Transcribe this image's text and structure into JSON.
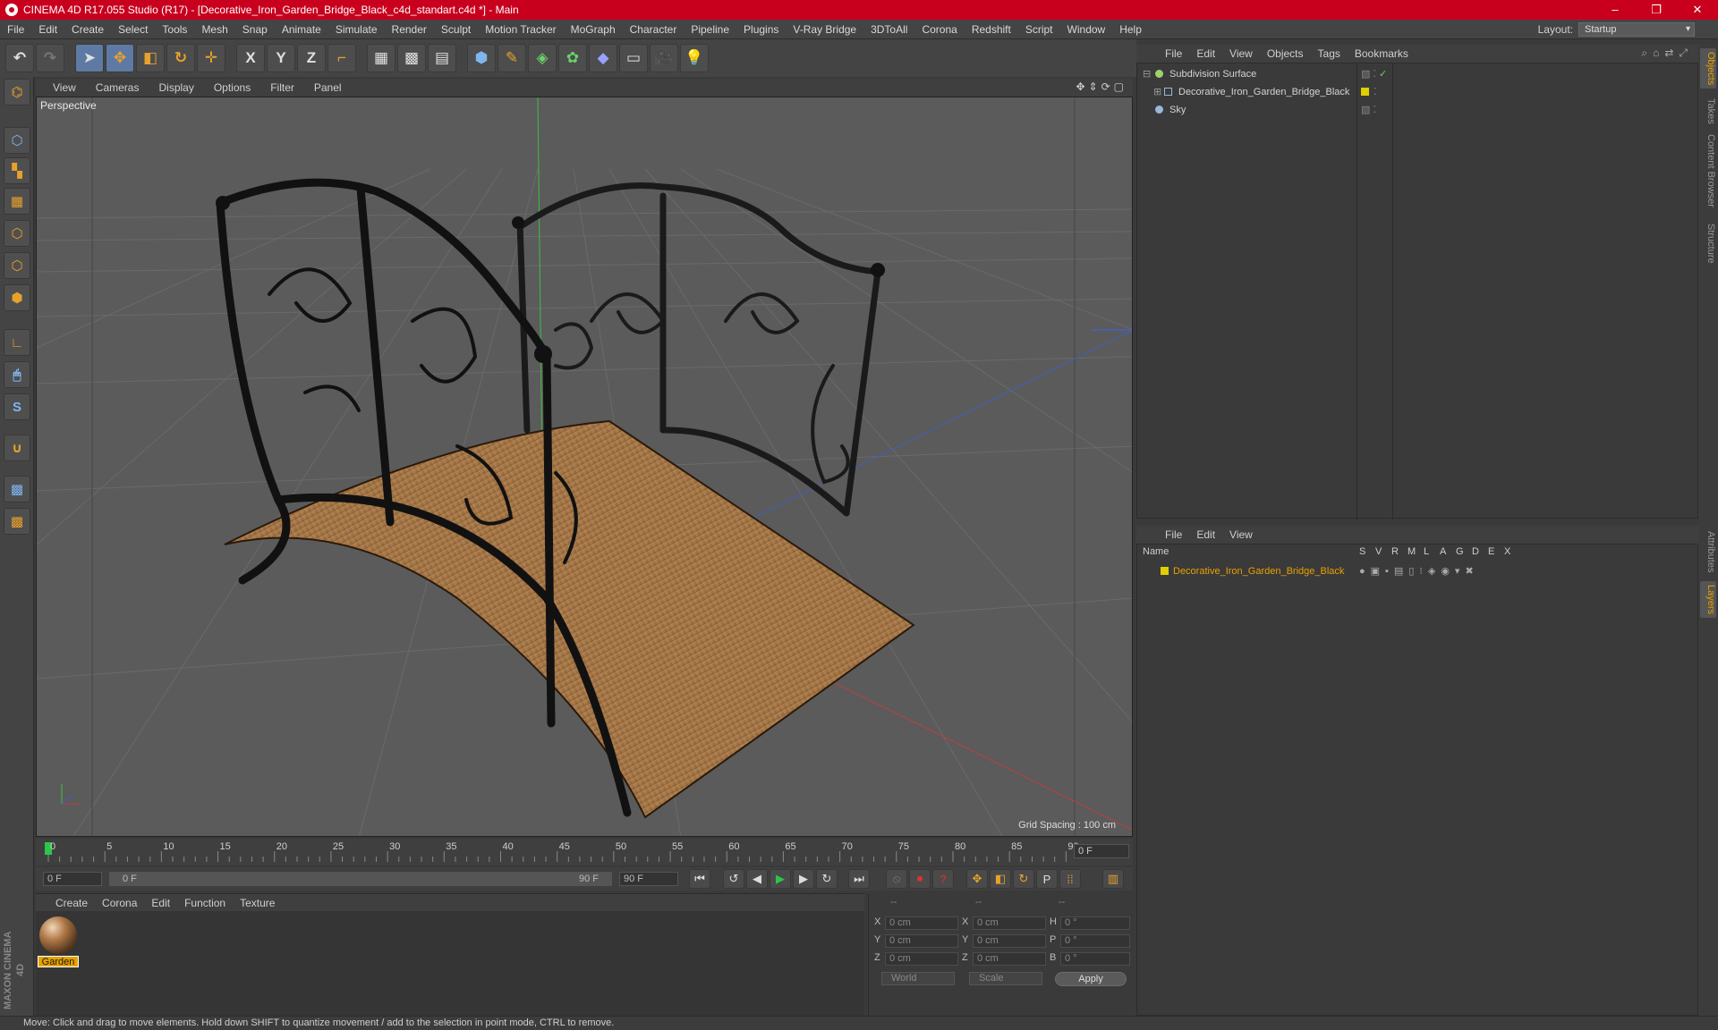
{
  "window": {
    "title": "CINEMA 4D R17.055 Studio (R17) - [Decorative_Iron_Garden_Bridge_Black_c4d_standart.c4d *] - Main",
    "minimize": "–",
    "restore": "❐",
    "close": "✕"
  },
  "menubar": {
    "items": [
      "File",
      "Edit",
      "Create",
      "Select",
      "Tools",
      "Mesh",
      "Snap",
      "Animate",
      "Simulate",
      "Render",
      "Sculpt",
      "Motion Tracker",
      "MoGraph",
      "Character",
      "Pipeline",
      "Plugins",
      "V-Ray Bridge",
      "3DToAll",
      "Corona",
      "Redshift",
      "Script",
      "Window",
      "Help"
    ],
    "layout_label": "Layout:",
    "layout_value": "Startup"
  },
  "toolbar": {
    "icons": [
      "undo-icon",
      "redo-icon",
      "select-arrow-icon",
      "move-icon",
      "scale-icon",
      "rotate-icon",
      "live-selection-icon",
      "x-axis-icon",
      "y-axis-icon",
      "z-axis-icon",
      "coordinate-system-icon",
      "render-view-icon",
      "render-picture-viewer-icon",
      "render-settings-icon",
      "cube-primitive-icon",
      "spline-pen-icon",
      "nurbs-icon",
      "array-icon",
      "deformer-icon",
      "floor-icon",
      "camera-icon",
      "light-icon"
    ],
    "x_label": "X",
    "y_label": "Y",
    "z_label": "Z"
  },
  "viewport": {
    "menu": [
      "View",
      "Cameras",
      "Display",
      "Options",
      "Filter",
      "Panel"
    ],
    "label": "Perspective",
    "grid_spacing": "Grid Spacing : 100 cm"
  },
  "timeline": {
    "ticks": [
      "0",
      "5",
      "10",
      "15",
      "20",
      "25",
      "30",
      "35",
      "40",
      "45",
      "50",
      "55",
      "60",
      "65",
      "70",
      "75",
      "80",
      "85",
      "90"
    ],
    "current_frame": "0 F",
    "start_field": "0 F",
    "range_start": "0 F",
    "range_end": "90 F",
    "end_field": "90 F"
  },
  "materials": {
    "menu": [
      "Create",
      "Corona",
      "Edit",
      "Function",
      "Texture"
    ],
    "items": [
      {
        "name": "Garden"
      }
    ]
  },
  "coordinates": {
    "header": [
      "--",
      "--",
      "--"
    ],
    "rows": [
      {
        "a": "X",
        "av": "0 cm",
        "b": "X",
        "bv": "0 cm",
        "c": "H",
        "cv": "0 °"
      },
      {
        "a": "Y",
        "av": "0 cm",
        "b": "Y",
        "bv": "0 cm",
        "c": "P",
        "cv": "0 °"
      },
      {
        "a": "Z",
        "av": "0 cm",
        "b": "Z",
        "bv": "0 cm",
        "c": "B",
        "cv": "0 °"
      }
    ],
    "space": "World",
    "mode": "Scale",
    "apply": "Apply"
  },
  "objects": {
    "menu": [
      "File",
      "Edit",
      "View",
      "Objects",
      "Tags",
      "Bookmarks"
    ],
    "items": [
      {
        "name": "Subdivision Surface",
        "color": "#9fd26a"
      },
      {
        "name": "Decorative_Iron_Garden_Bridge_Black",
        "color": "#e0d000"
      },
      {
        "name": "Sky",
        "color": "#9ab8d8"
      }
    ]
  },
  "layers": {
    "menu": [
      "File",
      "Edit",
      "View"
    ],
    "header_name": "Name",
    "header_cols": [
      "S",
      "V",
      "R",
      "M",
      "L",
      "A",
      "G",
      "D",
      "E",
      "X"
    ],
    "items": [
      {
        "name": "Decorative_Iron_Garden_Bridge_Black",
        "color": "#e0d000"
      }
    ]
  },
  "side_tabs": [
    "Objects",
    "Takes",
    "Content Browser",
    "Structure",
    "Attributes",
    "Layers"
  ],
  "brand": "MAXON CINEMA 4D",
  "status": "Move: Click and drag to move elements. Hold down SHIFT to quantize movement / add to the selection in point mode, CTRL to remove."
}
